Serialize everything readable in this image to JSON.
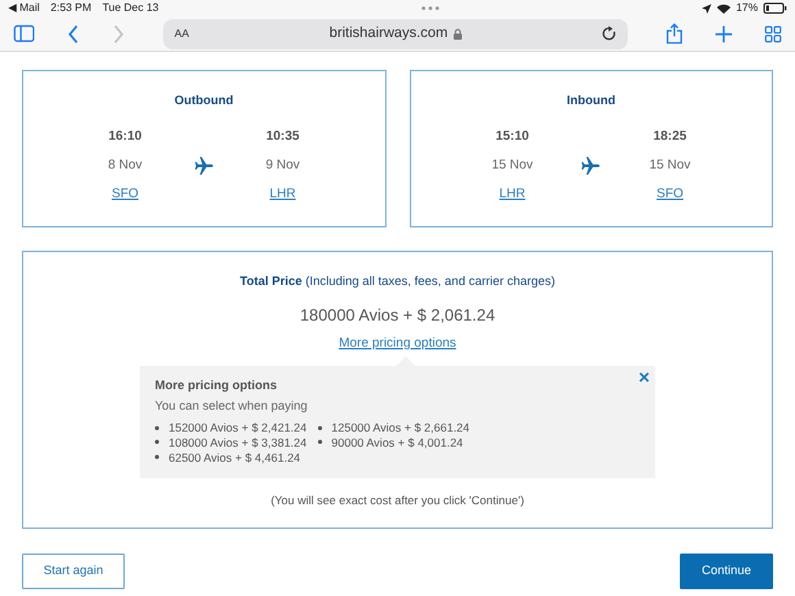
{
  "status_bar": {
    "back_app": "◀ Mail",
    "time": "2:53 PM",
    "date": "Tue Dec 13",
    "battery": "17%"
  },
  "toolbar": {
    "back_disabled": false,
    "forward_disabled": true,
    "text_size": "AA",
    "url": "britishairways.com"
  },
  "flights": [
    {
      "title": "Outbound",
      "departure": {
        "time": "16:10",
        "date": "8 Nov",
        "airport": "SFO"
      },
      "arrival": {
        "time": "10:35",
        "date": "9 Nov",
        "airport": "LHR"
      }
    },
    {
      "title": "Inbound",
      "departure": {
        "time": "15:10",
        "date": "15 Nov",
        "airport": "LHR"
      },
      "arrival": {
        "time": "18:25",
        "date": "15 Nov",
        "airport": "SFO"
      }
    }
  ],
  "price": {
    "label": "Total Price",
    "note": "(Including all taxes, fees, and carrier charges)",
    "amount": "180000 Avios + $ 2,061.24",
    "link": "More pricing options",
    "popover": {
      "title": "More pricing options",
      "subtitle": "You can select when paying",
      "close": "×",
      "options": [
        "152000 Avios + $ 2,421.24",
        "125000 Avios + $ 2,661.24",
        "108000 Avios + $ 3,381.24",
        "90000 Avios + $ 4,001.24",
        "62500 Avios + $ 4,461.24"
      ]
    },
    "footnote": "(You will see exact cost after you click 'Continue')"
  },
  "buttons": [
    {
      "label": "Start again",
      "kind": "outline"
    },
    {
      "label": "Continue",
      "kind": "primary"
    }
  ]
}
